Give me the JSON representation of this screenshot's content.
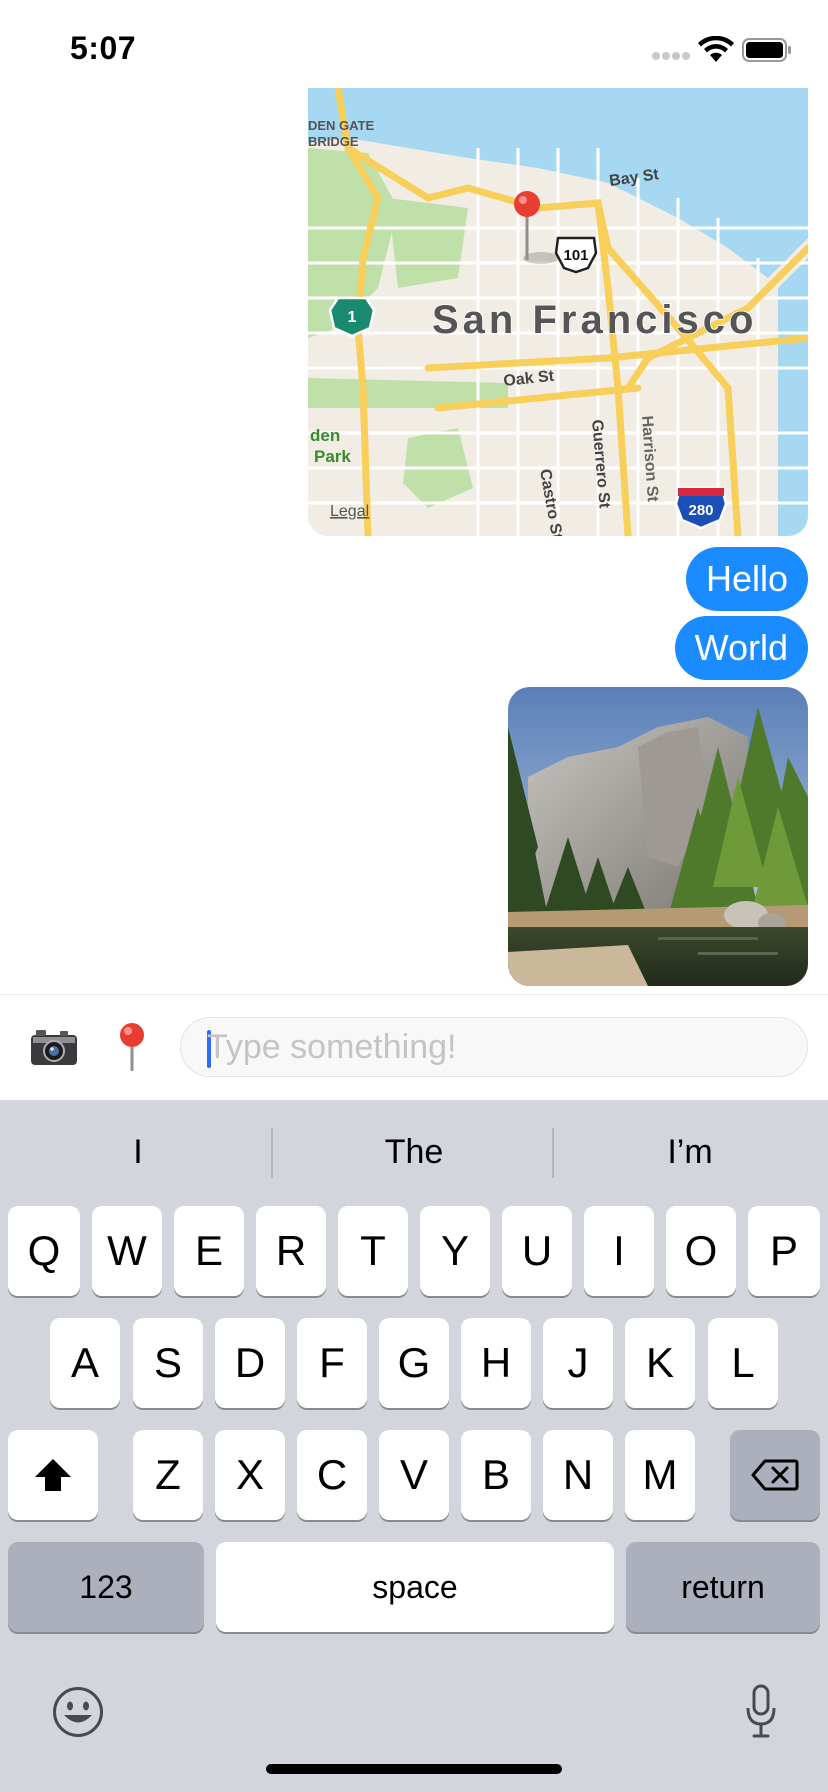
{
  "status_bar": {
    "time": "5:07",
    "signal_icon": "cellular-dots-icon",
    "wifi_icon": "wifi-icon",
    "battery_icon": "battery-full-icon"
  },
  "messages": {
    "map": {
      "city_label": "San Francisco",
      "street_labels": [
        "Bay St",
        "Oak St",
        "Castro St",
        "Guerrero St",
        "Harrison St"
      ],
      "place_labels": [
        "DEN GATE",
        "BRIDGE",
        "den",
        "Park"
      ],
      "route_shields": [
        "101",
        "1",
        "280"
      ],
      "legal_label": "Legal",
      "colors": {
        "water": "#a6d8f2",
        "land": "#f1ede4",
        "park": "#bfe1a9",
        "road": "#f7cf5a",
        "pin": "#e93d32"
      }
    },
    "bubbles": [
      {
        "text": "Hello"
      },
      {
        "text": "World"
      }
    ],
    "photo": {
      "icon": "landscape-photo"
    },
    "bubble_color": "#1a8cff"
  },
  "input_bar": {
    "camera_icon": "camera-icon",
    "pin_icon": "map-pin-icon",
    "placeholder": "Type something!",
    "value": ""
  },
  "keyboard": {
    "suggestions": [
      "I",
      "The",
      "I’m"
    ],
    "row1": [
      "Q",
      "W",
      "E",
      "R",
      "T",
      "Y",
      "U",
      "I",
      "O",
      "P"
    ],
    "row2": [
      "A",
      "S",
      "D",
      "F",
      "G",
      "H",
      "J",
      "K",
      "L"
    ],
    "row3": [
      "Z",
      "X",
      "C",
      "V",
      "B",
      "N",
      "M"
    ],
    "shift_icon": "shift-arrow-icon",
    "delete_icon": "backspace-icon",
    "numbers_label": "123",
    "space_label": "space",
    "return_label": "return",
    "emoji_icon": "emoji-icon",
    "mic_icon": "microphone-icon"
  }
}
